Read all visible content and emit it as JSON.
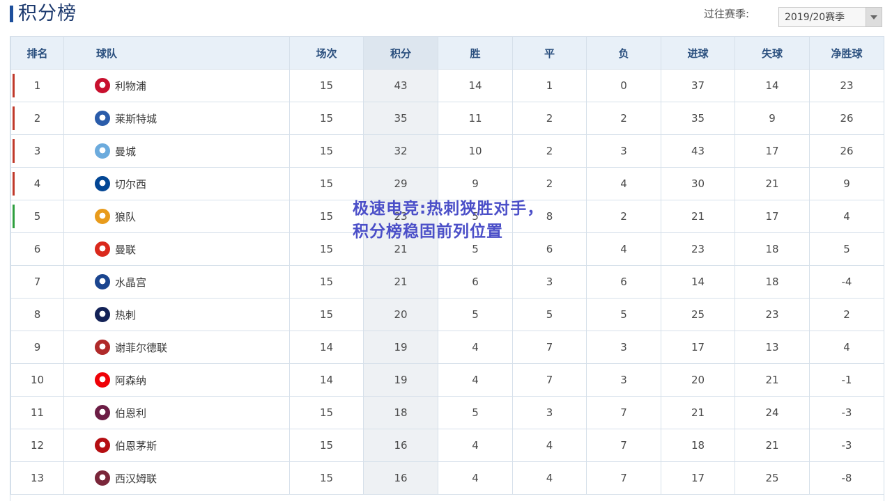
{
  "header": {
    "title": "积分榜",
    "season_label": "过往赛季:",
    "season_value": "2019/20赛季"
  },
  "table": {
    "columns": [
      "排名",
      "球队",
      "场次",
      "积分",
      "胜",
      "平",
      "负",
      "进球",
      "失球",
      "净胜球"
    ],
    "rows": [
      {
        "rank": "1",
        "team": "利物浦",
        "played": "15",
        "points": "43",
        "won": "14",
        "drawn": "1",
        "lost": "0",
        "gf": "37",
        "ga": "14",
        "gd": "23",
        "zone_color": "#c0392b",
        "icon": "liverpool-crest-icon",
        "icon_color": "#c8102e"
      },
      {
        "rank": "2",
        "team": "莱斯特城",
        "played": "15",
        "points": "35",
        "won": "11",
        "drawn": "2",
        "lost": "2",
        "gf": "35",
        "ga": "9",
        "gd": "26",
        "zone_color": "#c0392b",
        "icon": "leicester-crest-icon",
        "icon_color": "#2a5caa"
      },
      {
        "rank": "3",
        "team": "曼城",
        "played": "15",
        "points": "32",
        "won": "10",
        "drawn": "2",
        "lost": "3",
        "gf": "43",
        "ga": "17",
        "gd": "26",
        "zone_color": "#c0392b",
        "icon": "mancity-crest-icon",
        "icon_color": "#6cabdd"
      },
      {
        "rank": "4",
        "team": "切尔西",
        "played": "15",
        "points": "29",
        "won": "9",
        "drawn": "2",
        "lost": "4",
        "gf": "30",
        "ga": "21",
        "gd": "9",
        "zone_color": "#c0392b",
        "icon": "chelsea-crest-icon",
        "icon_color": "#034694"
      },
      {
        "rank": "5",
        "team": "狼队",
        "played": "15",
        "points": "23",
        "won": "5",
        "drawn": "8",
        "lost": "2",
        "gf": "21",
        "ga": "17",
        "gd": "4",
        "zone_color": "#2e9e3e",
        "icon": "wolves-crest-icon",
        "icon_color": "#e89b1c"
      },
      {
        "rank": "6",
        "team": "曼联",
        "played": "15",
        "points": "21",
        "won": "5",
        "drawn": "6",
        "lost": "4",
        "gf": "23",
        "ga": "18",
        "gd": "5",
        "zone_color": "",
        "icon": "manutd-crest-icon",
        "icon_color": "#da291c"
      },
      {
        "rank": "7",
        "team": "水晶宫",
        "played": "15",
        "points": "21",
        "won": "6",
        "drawn": "3",
        "lost": "6",
        "gf": "14",
        "ga": "18",
        "gd": "-4",
        "zone_color": "",
        "icon": "crystalpalace-crest-icon",
        "icon_color": "#1b458f"
      },
      {
        "rank": "8",
        "team": "热刺",
        "played": "15",
        "points": "20",
        "won": "5",
        "drawn": "5",
        "lost": "5",
        "gf": "25",
        "ga": "23",
        "gd": "2",
        "zone_color": "",
        "icon": "tottenham-crest-icon",
        "icon_color": "#132257"
      },
      {
        "rank": "9",
        "team": "谢菲尔德联",
        "played": "14",
        "points": "19",
        "won": "4",
        "drawn": "7",
        "lost": "3",
        "gf": "17",
        "ga": "13",
        "gd": "4",
        "zone_color": "",
        "icon": "sheffieldutd-crest-icon",
        "icon_color": "#b02a2a"
      },
      {
        "rank": "10",
        "team": "阿森纳",
        "played": "14",
        "points": "19",
        "won": "4",
        "drawn": "7",
        "lost": "3",
        "gf": "20",
        "ga": "21",
        "gd": "-1",
        "zone_color": "",
        "icon": "arsenal-crest-icon",
        "icon_color": "#ef0107"
      },
      {
        "rank": "11",
        "team": "伯恩利",
        "played": "15",
        "points": "18",
        "won": "5",
        "drawn": "3",
        "lost": "7",
        "gf": "21",
        "ga": "24",
        "gd": "-3",
        "zone_color": "",
        "icon": "burnley-crest-icon",
        "icon_color": "#6c1d45"
      },
      {
        "rank": "12",
        "team": "伯恩茅斯",
        "played": "15",
        "points": "16",
        "won": "4",
        "drawn": "4",
        "lost": "7",
        "gf": "18",
        "ga": "21",
        "gd": "-3",
        "zone_color": "",
        "icon": "bournemouth-crest-icon",
        "icon_color": "#b50e12"
      },
      {
        "rank": "13",
        "team": "西汉姆联",
        "played": "15",
        "points": "16",
        "won": "4",
        "drawn": "4",
        "lost": "7",
        "gf": "17",
        "ga": "25",
        "gd": "-8",
        "zone_color": "",
        "icon": "westham-crest-icon",
        "icon_color": "#7a263a"
      }
    ]
  },
  "overlay": {
    "text": "极速电竞:热刺狭胜对手，积分榜稳固前列位置"
  },
  "colors": {
    "header_bg": "#e8f0f8",
    "points_col_bg": "#eef1f4",
    "title_color": "#1e3b6f",
    "overlay_color": "#4b4fc8"
  }
}
